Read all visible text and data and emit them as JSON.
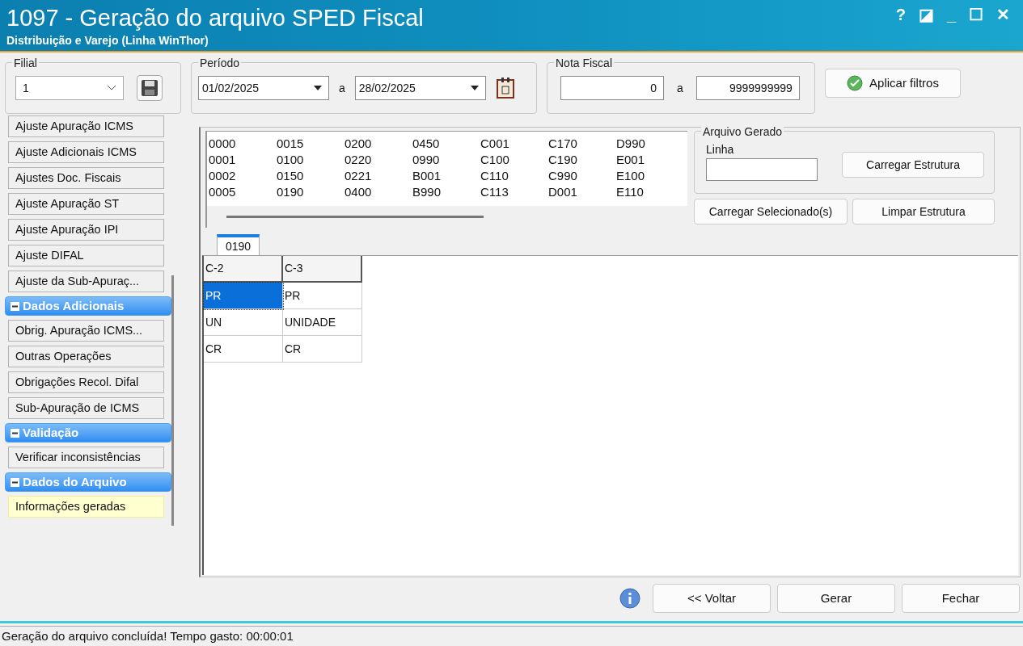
{
  "window": {
    "title": "1097 - Geração do arquivo SPED Fiscal",
    "subtitle": "Distribuição e Varejo (Linha WinThor)",
    "controls": [
      "?",
      "◪",
      "_",
      "☐",
      "✕"
    ]
  },
  "filters": {
    "filial": {
      "label": "Filial",
      "value": "1"
    },
    "periodo": {
      "label": "Período",
      "from": "01/02/2025",
      "separator": "a",
      "to": "28/02/2025"
    },
    "nota_fiscal": {
      "label": "Nota Fiscal",
      "from": "0",
      "separator": "a",
      "to": "9999999999"
    },
    "apply_button": "Aplicar filtros"
  },
  "sidebar": {
    "items": [
      {
        "label": "Ajuste Apuração ICMS",
        "selected": false
      },
      {
        "label": "Ajuste Adicionais ICMS",
        "selected": false
      },
      {
        "label": "Ajustes Doc. Fiscais",
        "selected": false
      },
      {
        "label": "Ajuste Apuração ST",
        "selected": false
      },
      {
        "label": "Ajuste Apuração IPI",
        "selected": false
      },
      {
        "label": "Ajuste DIFAL",
        "selected": false
      },
      {
        "label": "Ajuste da Sub-Apuraç...",
        "selected": false
      }
    ],
    "sections": [
      {
        "title": "Dados Adicionais",
        "expanded": true,
        "items": [
          {
            "label": "Obrig. Apuração ICMS...",
            "selected": false
          },
          {
            "label": "Outras Operações",
            "selected": false
          },
          {
            "label": "Obrigações Recol. Difal",
            "selected": false
          },
          {
            "label": "Sub-Apuração de ICMS",
            "selected": false
          }
        ]
      },
      {
        "title": "Validação",
        "expanded": true,
        "items": [
          {
            "label": "Verificar inconsistências",
            "selected": false
          }
        ]
      },
      {
        "title": "Dados do Arquivo",
        "expanded": true,
        "items": [
          {
            "label": "Informações geradas",
            "selected": true
          }
        ]
      }
    ]
  },
  "registers": [
    [
      "0000",
      "0015",
      "0200",
      "0450",
      "C001",
      "C170",
      "D990"
    ],
    [
      "0001",
      "0100",
      "0220",
      "0990",
      "C100",
      "C190",
      "E001"
    ],
    [
      "0002",
      "0150",
      "0221",
      "B001",
      "C110",
      "C990",
      "E100"
    ],
    [
      "0005",
      "0190",
      "0400",
      "B990",
      "C113",
      "D001",
      "E110"
    ]
  ],
  "arquivo_gerado": {
    "label": "Arquivo Gerado",
    "linha_label": "Linha",
    "load_structure_button": "Carregar Estrutura"
  },
  "load_selected_button": "Carregar Selecionado(s)",
  "clear_structure_button": "Limpar Estrutura",
  "tabs": [
    {
      "label": "0190",
      "selected": true
    }
  ],
  "table": {
    "columns": [
      "C-2",
      "C-3"
    ],
    "rows": [
      {
        "cells": [
          "PR",
          "PR"
        ],
        "selected": true
      },
      {
        "cells": [
          "UN",
          "UNIDADE"
        ],
        "selected": false
      },
      {
        "cells": [
          "CR",
          "CR"
        ],
        "selected": false
      }
    ]
  },
  "buttons": [
    "<< Voltar",
    "Gerar",
    "Fechar"
  ],
  "status_bar": "Geração do arquivo concluída! Tempo gasto: 00:00:01"
}
